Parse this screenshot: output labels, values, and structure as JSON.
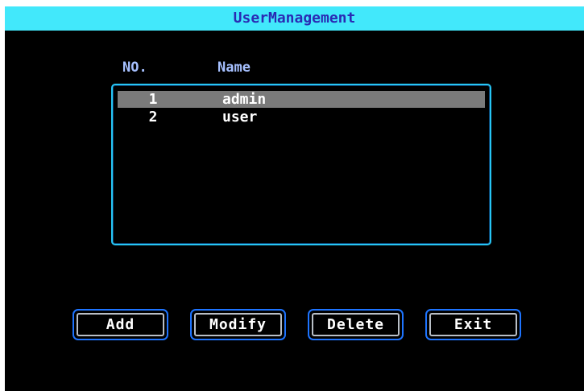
{
  "window": {
    "title": "UserManagement"
  },
  "user_list": {
    "headers": {
      "no": "NO.",
      "name": "Name"
    },
    "rows": [
      {
        "no": "1",
        "name": "admin",
        "selected": true
      },
      {
        "no": "2",
        "name": "user",
        "selected": false
      }
    ]
  },
  "buttons": {
    "add": "Add",
    "modify": "Modify",
    "delete": "Delete",
    "exit": "Exit"
  },
  "colors": {
    "title_bar": "#42e8fb",
    "title_text": "#2a2ab4",
    "header_text": "#a6c0ff",
    "list_border": "#27c6f5",
    "selected_row": "#7a7a7a",
    "button_border": "#1e74ff",
    "background": "#000000"
  }
}
